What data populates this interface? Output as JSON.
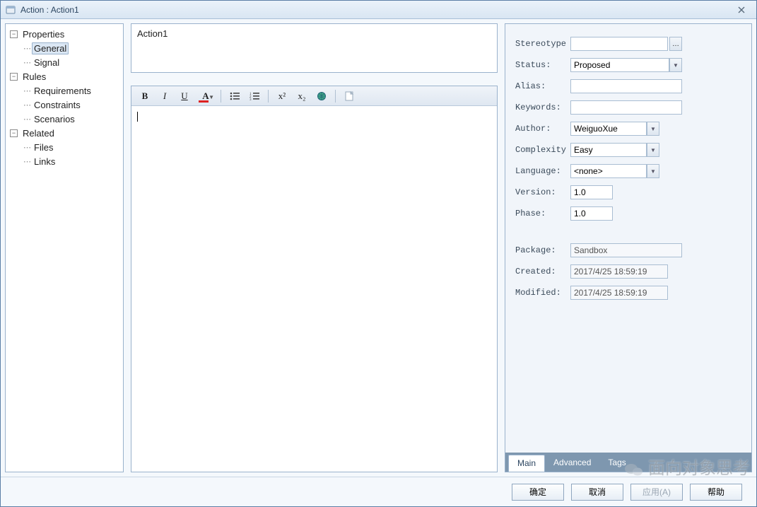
{
  "window": {
    "title": "Action : Action1"
  },
  "tree": {
    "properties": "Properties",
    "general": "General",
    "signal": "Signal",
    "rules": "Rules",
    "requirements": "Requirements",
    "constraints": "Constraints",
    "scenarios": "Scenarios",
    "related": "Related",
    "files": "Files",
    "links": "Links",
    "selected": "general"
  },
  "main": {
    "name": "Action1",
    "description": ""
  },
  "toolbar": {
    "bold": "B",
    "italic": "I",
    "underline": "U",
    "fontcolor": "A",
    "sup": "x²",
    "sub": "x₂"
  },
  "props": {
    "labels": {
      "stereotype": "Stereotype",
      "status": "Status:",
      "alias": "Alias:",
      "keywords": "Keywords:",
      "author": "Author:",
      "complexity": "Complexity",
      "language": "Language:",
      "version": "Version:",
      "phase": "Phase:",
      "package": "Package:",
      "created": "Created:",
      "modified": "Modified:"
    },
    "values": {
      "stereotype": "",
      "status": "Proposed",
      "alias": "",
      "keywords": "",
      "author": "WeiguoXue",
      "complexity": "Easy",
      "language": "<none>",
      "version": "1.0",
      "phase": "1.0",
      "package": "Sandbox",
      "created": "2017/4/25 18:59:19",
      "modified": "2017/4/25 18:59:19"
    }
  },
  "tabs": {
    "main": "Main",
    "advanced": "Advanced",
    "tags": "Tags",
    "active": "main"
  },
  "buttons": {
    "ok": "确定",
    "cancel": "取消",
    "apply": "应用(A)",
    "help": "帮助"
  },
  "watermark": "面向对象思考"
}
